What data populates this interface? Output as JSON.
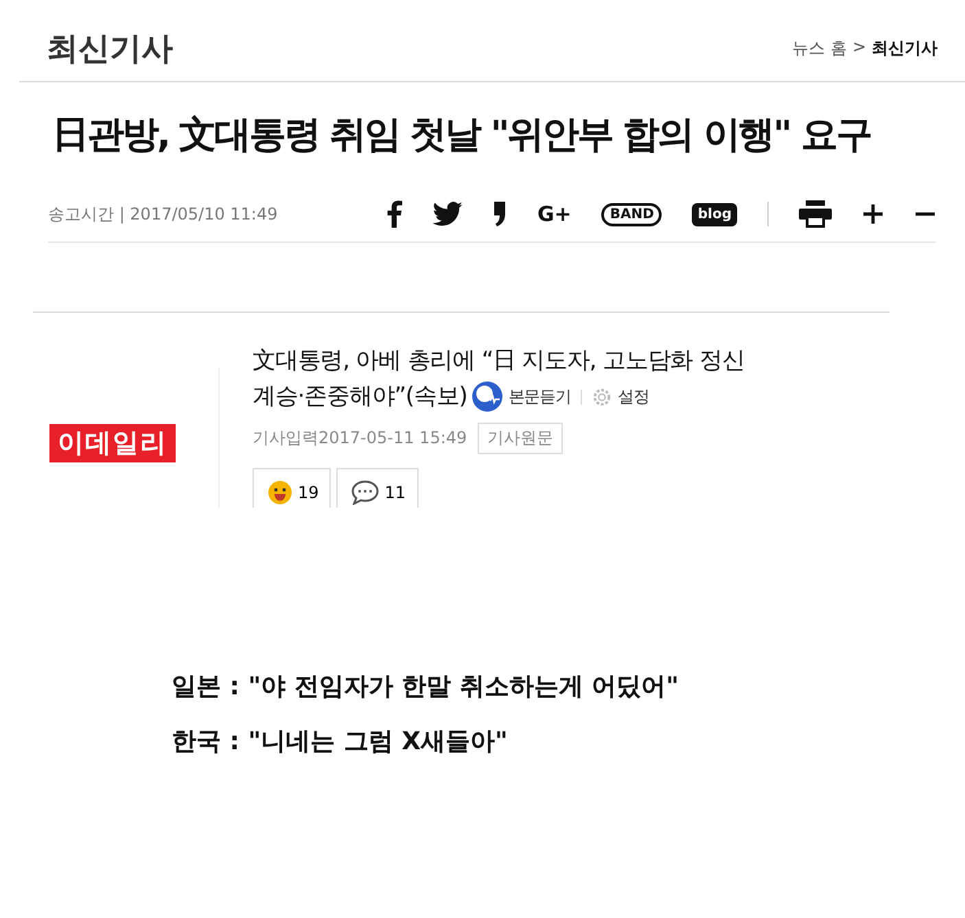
{
  "header": {
    "title": "최신기사",
    "breadcrumb": [
      {
        "text": "뉴스 홈",
        "current": false
      },
      {
        "text": ">",
        "current": false
      },
      {
        "text": "최신기사",
        "current": true
      }
    ]
  },
  "article": {
    "headline": "日관방, 文대통령 취임 첫날 \"위안부 합의 이행\" 요구",
    "sent_label": "송고시간",
    "sent_separator": "|",
    "sent_time": "2017/05/10 11:49",
    "share": [
      {
        "kind": "facebook"
      },
      {
        "kind": "twitter"
      },
      {
        "kind": "story"
      },
      {
        "kind": "text",
        "label": "G+"
      },
      {
        "kind": "band",
        "label": "BAND"
      },
      {
        "kind": "blog",
        "label": "blog"
      }
    ],
    "tools": [
      {
        "kind": "print"
      },
      {
        "kind": "plus"
      },
      {
        "kind": "minus"
      }
    ]
  },
  "embed": {
    "logo": "이데일리",
    "title_lines": [
      "文대통령, 아베 총리에 “日 지도자, 고노담화 정신",
      "계승·존중해야”(속보)"
    ],
    "listen": "본문듣기",
    "settings": "설정",
    "date_label": "기사입력",
    "date": "2017-05-11 15:49",
    "original": "기사원문",
    "reactions": [
      {
        "kind": "smile",
        "count": "19"
      },
      {
        "kind": "comment",
        "count": "11"
      }
    ]
  },
  "captions": [
    "일본 : \"야 전임자가 한말 취소하는게 어딨어\"",
    "한국 : \"니네는 그럼 X새들아\""
  ]
}
